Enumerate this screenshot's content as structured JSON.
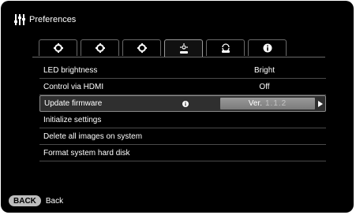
{
  "header": {
    "icon": "preferences-icon",
    "title": "Preferences"
  },
  "tabs": [
    {
      "icon": "gear-icon",
      "active": false
    },
    {
      "icon": "gear-icon",
      "active": false
    },
    {
      "icon": "gear-icon",
      "active": false
    },
    {
      "icon": "system-settings-icon",
      "active": true
    },
    {
      "icon": "cloud-sync-icon",
      "active": false
    },
    {
      "icon": "info-icon",
      "active": false
    }
  ],
  "rows": [
    {
      "label": "LED brightness",
      "value": "Bright"
    },
    {
      "label": "Control via HDMI",
      "value": "Off"
    },
    {
      "label": "Update firmware",
      "prefix": "Ver.",
      "version": "1.1.2"
    },
    {
      "label": "Initialize settings"
    },
    {
      "label": "Delete all images on system"
    },
    {
      "label": "Format system hard disk"
    }
  ],
  "footer": {
    "back_button": "BACK",
    "back_label": "Back"
  },
  "colors": {
    "background": "#000000",
    "selected_row": "#2f2f2f",
    "field": "#8a8a8a",
    "back_button": "#bdbdbd"
  }
}
